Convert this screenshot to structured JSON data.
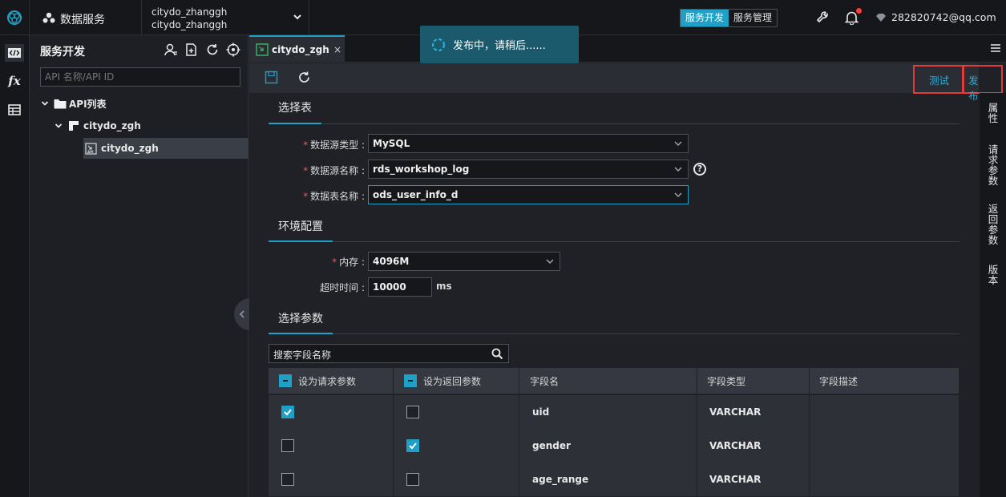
{
  "header": {
    "product": "数据服务",
    "workspace_line1": "citydo_zhanggh",
    "workspace_line2": "citydo_zhanggh",
    "mode_tabs": [
      "服务开发",
      "服务管理"
    ],
    "active_mode": "服务开发",
    "user": "282820742@qq.com"
  },
  "sidebar": {
    "title": "服务开发",
    "search_placeholder": "API 名称/API ID",
    "tree": [
      {
        "label": "API列表",
        "level": 0
      },
      {
        "label": "citydo_zgh",
        "level": 1
      },
      {
        "label": "citydo_zgh",
        "level": 2,
        "selected": true
      }
    ]
  },
  "editor": {
    "tab_label": "citydo_zgh",
    "tab_close": "×",
    "toolbar": {
      "test_label": "测试",
      "publish_label": "发布"
    },
    "right_rail": [
      "属性",
      "请求参数",
      "返回参数",
      "版本"
    ]
  },
  "toast": {
    "message": "发布中，请稍后......"
  },
  "form": {
    "select_table": {
      "title": "选择表",
      "datasource_type_label": "数据源类型 :",
      "datasource_type_value": "MySQL",
      "datasource_name_label": "数据源名称 :",
      "datasource_name_value": "rds_workshop_log",
      "table_name_label": "数据表名称 :",
      "table_name_value": "ods_user_info_d"
    },
    "env": {
      "title": "环境配置",
      "memory_label": "内存 :",
      "memory_value": "4096M",
      "timeout_label": "超时时间 :",
      "timeout_value": "10000",
      "timeout_unit": "ms"
    },
    "params": {
      "title": "选择参数",
      "search_placeholder": "搜索字段名称",
      "columns": [
        "设为请求参数",
        "设为返回参数",
        "字段名",
        "字段类型",
        "字段描述"
      ],
      "rows": [
        {
          "request": true,
          "response": false,
          "name": "uid",
          "type": "VARCHAR",
          "desc": ""
        },
        {
          "request": false,
          "response": true,
          "name": "gender",
          "type": "VARCHAR",
          "desc": ""
        },
        {
          "request": false,
          "response": false,
          "name": "age_range",
          "type": "VARCHAR",
          "desc": ""
        }
      ]
    }
  },
  "colors": {
    "accent": "#1fa0c6",
    "highlight_box": "#e23b3b",
    "required": "#ff4d4f",
    "notification_dot": "#ff3b3b"
  }
}
